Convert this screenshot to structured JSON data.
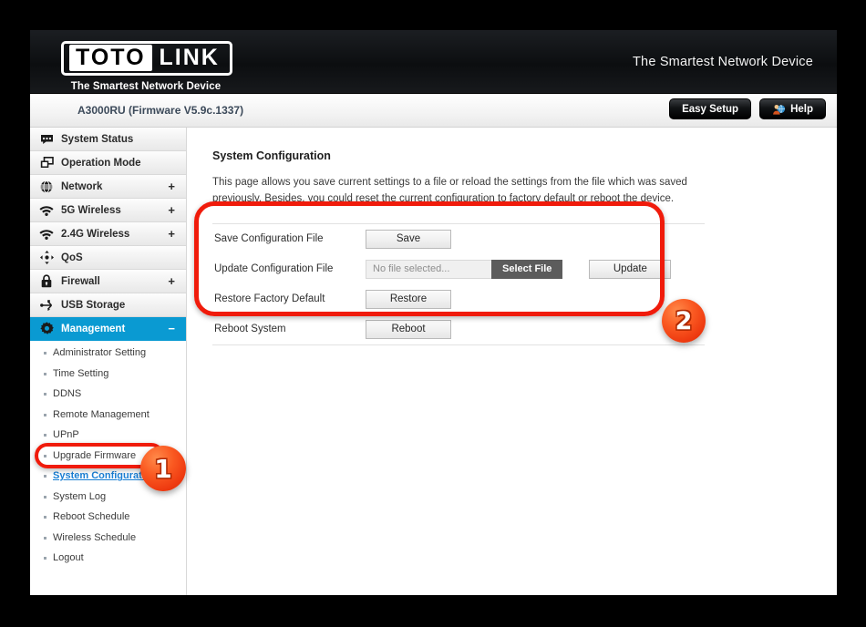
{
  "header": {
    "logo_first": "TOTO",
    "logo_second": "LINK",
    "logo_tagline": "The Smartest Network Device",
    "slogan": "The Smartest Network Device",
    "easy_setup_label": "Easy Setup",
    "help_label": "Help",
    "help_icon": "person-globe-icon"
  },
  "subheader": {
    "model": "A3000RU (Firmware V5.9c.1337)"
  },
  "sidebar": {
    "items": [
      {
        "label": "System Status",
        "icon": "speech-bubble-icon",
        "expander": "",
        "active": false
      },
      {
        "label": "Operation Mode",
        "icon": "windows-stack-icon",
        "expander": "",
        "active": false
      },
      {
        "label": "Network",
        "icon": "globe-icon",
        "expander": "+",
        "active": false
      },
      {
        "label": "5G Wireless",
        "icon": "wifi-icon",
        "expander": "+",
        "active": false
      },
      {
        "label": "2.4G Wireless",
        "icon": "wifi-icon",
        "expander": "+",
        "active": false
      },
      {
        "label": "QoS",
        "icon": "move-arrows-icon",
        "expander": "",
        "active": false
      },
      {
        "label": "Firewall",
        "icon": "lock-icon",
        "expander": "+",
        "active": false
      },
      {
        "label": "USB Storage",
        "icon": "usb-icon",
        "expander": "",
        "active": false
      },
      {
        "label": "Management",
        "icon": "gear-icon",
        "expander": "−",
        "active": true
      }
    ],
    "subitems": [
      {
        "label": "Administrator Setting",
        "selected": false
      },
      {
        "label": "Time Setting",
        "selected": false
      },
      {
        "label": "DDNS",
        "selected": false
      },
      {
        "label": "Remote Management",
        "selected": false
      },
      {
        "label": "UPnP",
        "selected": false
      },
      {
        "label": "Upgrade Firmware",
        "selected": false
      },
      {
        "label": "System Configuration",
        "selected": true
      },
      {
        "label": "System Log",
        "selected": false
      },
      {
        "label": "Reboot Schedule",
        "selected": false
      },
      {
        "label": "Wireless Schedule",
        "selected": false
      },
      {
        "label": "Logout",
        "selected": false
      }
    ]
  },
  "content": {
    "title": "System Configuration",
    "description": "This page allows you save current settings to a file or reload the settings from the file which was saved previously. Besides, you could reset the current configuration to factory default or reboot the device.",
    "rows": {
      "save_label": "Save Configuration File",
      "save_button": "Save",
      "update_label": "Update Configuration File",
      "file_placeholder": "No file selected...",
      "select_file_button": "Select File",
      "update_button": "Update",
      "restore_label": "Restore Factory Default",
      "restore_button": "Restore",
      "reboot_label": "Reboot System",
      "reboot_button": "Reboot"
    }
  },
  "annotations": {
    "badge_one": "1",
    "badge_two": "2",
    "highlight_color": "#f01b0b",
    "badge_color": "#f4501b"
  }
}
